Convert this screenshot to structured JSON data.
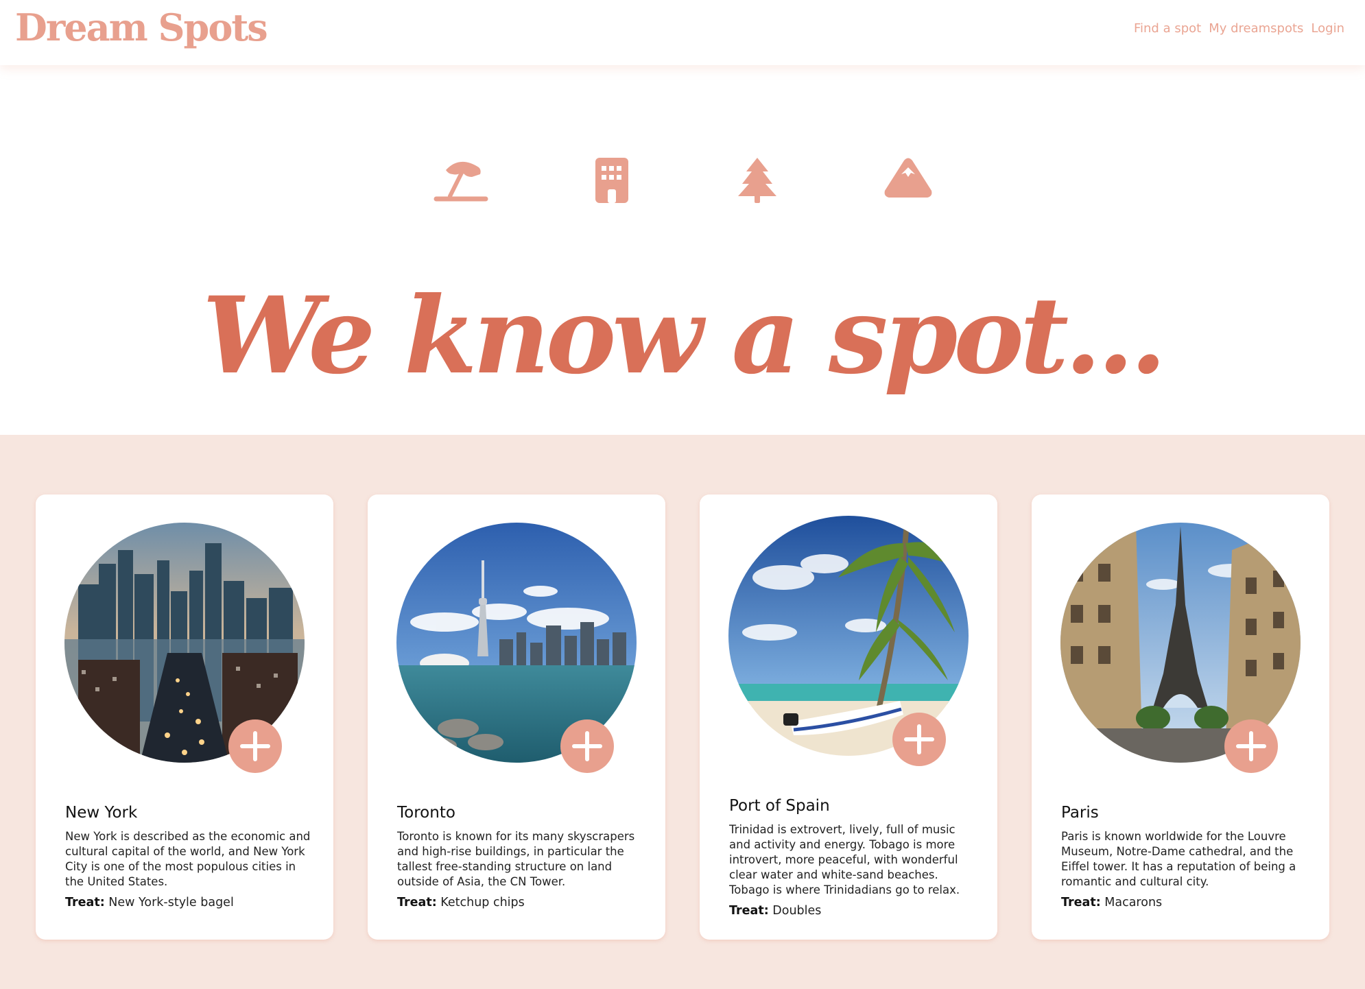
{
  "header": {
    "logo": "Dream Spots",
    "nav": [
      "Find a spot",
      "My dreamspots",
      "Login"
    ]
  },
  "categories": [
    {
      "icon": "beach-umbrella-icon"
    },
    {
      "icon": "building-icon"
    },
    {
      "icon": "pine-tree-icon"
    },
    {
      "icon": "mountain-icon"
    }
  ],
  "hero": "We know a spot...",
  "cards": [
    {
      "city": "New York",
      "description": "New York is described as the economic and cultural capital of the world, and New York City is one of the most populous cities in the United States.",
      "treat_label": "Treat:",
      "treat": "New York-style bagel"
    },
    {
      "city": "Toronto",
      "description": "Toronto is known for its many skyscrapers and high-rise buildings, in particular the tallest free-standing structure on land outside of Asia, the CN Tower.",
      "treat_label": "Treat:",
      "treat": "Ketchup chips"
    },
    {
      "city": "Port of Spain",
      "description": "Trinidad is extrovert, lively, full of music and activity and energy. Tobago is more introvert, more peaceful, with wonderful clear water and white-sand beaches. Tobago is where Trinidadians go to relax.",
      "treat_label": "Treat:",
      "treat": "Doubles"
    },
    {
      "city": "Paris",
      "description": "Paris is known worldwide for the Louvre Museum, Notre-Dame cathedral, and the Eiffel tower. It has a reputation of being a romantic and cultural city.",
      "treat_label": "Treat:",
      "treat": "Macarons"
    }
  ],
  "colors": {
    "accent": "#e8a08e",
    "hero": "#d97058",
    "band": "#f7e6df"
  }
}
